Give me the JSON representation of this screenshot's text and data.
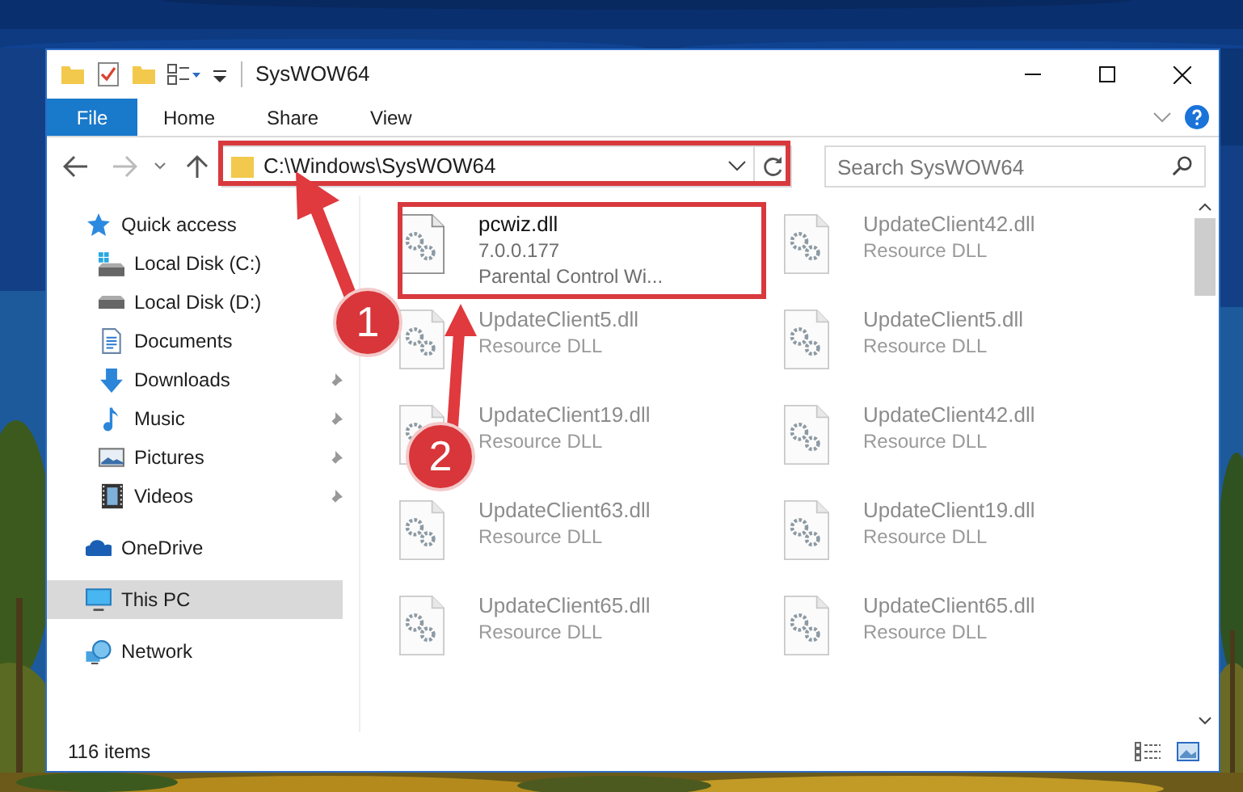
{
  "window": {
    "title": "SysWOW64"
  },
  "ribbon": {
    "tabs": [
      {
        "label": "File",
        "kind": "file",
        "selected": false
      },
      {
        "label": "Home",
        "kind": "tab",
        "selected": false
      },
      {
        "label": "Share",
        "kind": "tab",
        "selected": false
      },
      {
        "label": "View",
        "kind": "tab",
        "selected": false
      }
    ]
  },
  "address_bar": {
    "path": "C:\\Windows\\SysWOW64"
  },
  "search": {
    "placeholder": "Search SysWOW64"
  },
  "navigation": [
    {
      "label": "Quick access",
      "kind": "star",
      "selected": false,
      "children": [
        {
          "label": "Local Disk (C:)",
          "kind": "drive-windows",
          "pinned": false,
          "selected": false
        },
        {
          "label": "Local Disk (D:)",
          "kind": "drive",
          "pinned": false,
          "selected": false
        },
        {
          "label": "Documents",
          "kind": "documents",
          "pinned": false,
          "selected": false
        },
        {
          "label": "Downloads",
          "kind": "downloads",
          "pinned": true,
          "selected": false
        },
        {
          "label": "Music",
          "kind": "music",
          "pinned": true,
          "selected": false
        },
        {
          "label": "Pictures",
          "kind": "pictures",
          "pinned": true,
          "selected": false
        },
        {
          "label": "Videos",
          "kind": "videos",
          "pinned": true,
          "selected": false
        }
      ]
    },
    {
      "label": "OneDrive",
      "kind": "onedrive",
      "selected": false
    },
    {
      "label": "This PC",
      "kind": "pc",
      "selected": true
    },
    {
      "label": "Network",
      "kind": "network",
      "selected": false
    }
  ],
  "files": [
    {
      "name": "pcwiz.dll",
      "details": [
        "7.0.0.177",
        "Parental Control Wi..."
      ],
      "blurred": false
    },
    {
      "name": "UpdateClient42.dll",
      "details": [
        "Resource DLL"
      ],
      "blurred": true
    },
    {
      "name": "UpdateClient5.dll",
      "details": [
        "Resource DLL"
      ],
      "blurred": true
    },
    {
      "name": "UpdateClient5.dll",
      "details": [
        "Resource DLL"
      ],
      "blurred": true
    },
    {
      "name": "UpdateClient19.dll",
      "details": [
        "Resource DLL"
      ],
      "blurred": true
    },
    {
      "name": "UpdateClient42.dll",
      "details": [
        "Resource DLL"
      ],
      "blurred": true
    },
    {
      "name": "UpdateClient63.dll",
      "details": [
        "Resource DLL"
      ],
      "blurred": true
    },
    {
      "name": "UpdateClient19.dll",
      "details": [
        "Resource DLL"
      ],
      "blurred": true
    },
    {
      "name": "UpdateClient65.dll",
      "details": [
        "Resource DLL"
      ],
      "blurred": true
    },
    {
      "name": "UpdateClient65.dll",
      "details": [
        "Resource DLL"
      ],
      "blurred": true
    }
  ],
  "status_bar": {
    "item_count": "116 items"
  },
  "annotations": [
    {
      "label": "1"
    },
    {
      "label": "2"
    }
  ]
}
